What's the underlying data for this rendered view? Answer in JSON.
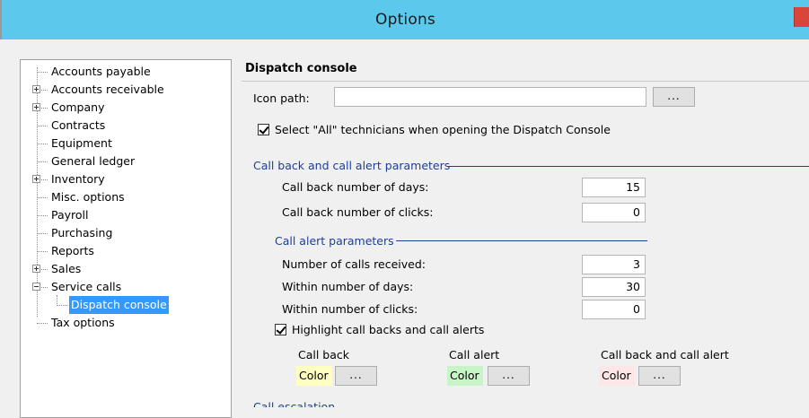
{
  "window": {
    "title": "Options"
  },
  "tree": {
    "items": [
      {
        "label": "Accounts payable",
        "expander": "none"
      },
      {
        "label": "Accounts receivable",
        "expander": "plus"
      },
      {
        "label": "Company",
        "expander": "plus"
      },
      {
        "label": "Contracts",
        "expander": "none"
      },
      {
        "label": "Equipment",
        "expander": "none"
      },
      {
        "label": "General ledger",
        "expander": "none"
      },
      {
        "label": "Inventory",
        "expander": "plus"
      },
      {
        "label": "Misc. options",
        "expander": "none"
      },
      {
        "label": "Payroll",
        "expander": "none"
      },
      {
        "label": "Purchasing",
        "expander": "none"
      },
      {
        "label": "Reports",
        "expander": "none"
      },
      {
        "label": "Sales",
        "expander": "plus"
      },
      {
        "label": "Service calls",
        "expander": "minus"
      },
      {
        "label": "Dispatch console",
        "expander": "none",
        "child": true,
        "selected": true
      },
      {
        "label": "Tax options",
        "expander": "none"
      }
    ]
  },
  "panel": {
    "section_title": "Dispatch console",
    "icon_path": {
      "label": "Icon path:",
      "value": "",
      "browse_label": "..."
    },
    "select_all": {
      "label": "Select \"All\" technicians when opening the Dispatch Console",
      "checked": true
    },
    "callback_group": {
      "title": "Call back and call alert parameters",
      "days": {
        "label": "Call back number of days:",
        "value": "15"
      },
      "clicks": {
        "label": "Call back number of clicks:",
        "value": "0"
      }
    },
    "alert_group": {
      "title": "Call alert parameters",
      "received": {
        "label": "Number of calls received:",
        "value": "3"
      },
      "days": {
        "label": "Within number of days:",
        "value": "30"
      },
      "clicks": {
        "label": "Within number of clicks:",
        "value": "0"
      }
    },
    "highlight": {
      "label": "Highlight call backs and call alerts",
      "checked": true
    },
    "colors": [
      {
        "heading": "Call back",
        "swatch_label": "Color",
        "swatch_color": "#ffffc0",
        "button_label": "..."
      },
      {
        "heading": "Call alert",
        "swatch_label": "Color",
        "swatch_color": "#c8f5c8",
        "button_label": "..."
      },
      {
        "heading": "Call back and call alert",
        "swatch_label": "Color",
        "swatch_color": "#fde6e6",
        "button_label": "..."
      }
    ],
    "next_group_title": "Call escalation"
  },
  "colors": {
    "titlebar": "#5cc9ec",
    "group_heading": "#1c3f94",
    "selection": "#3399ff"
  }
}
